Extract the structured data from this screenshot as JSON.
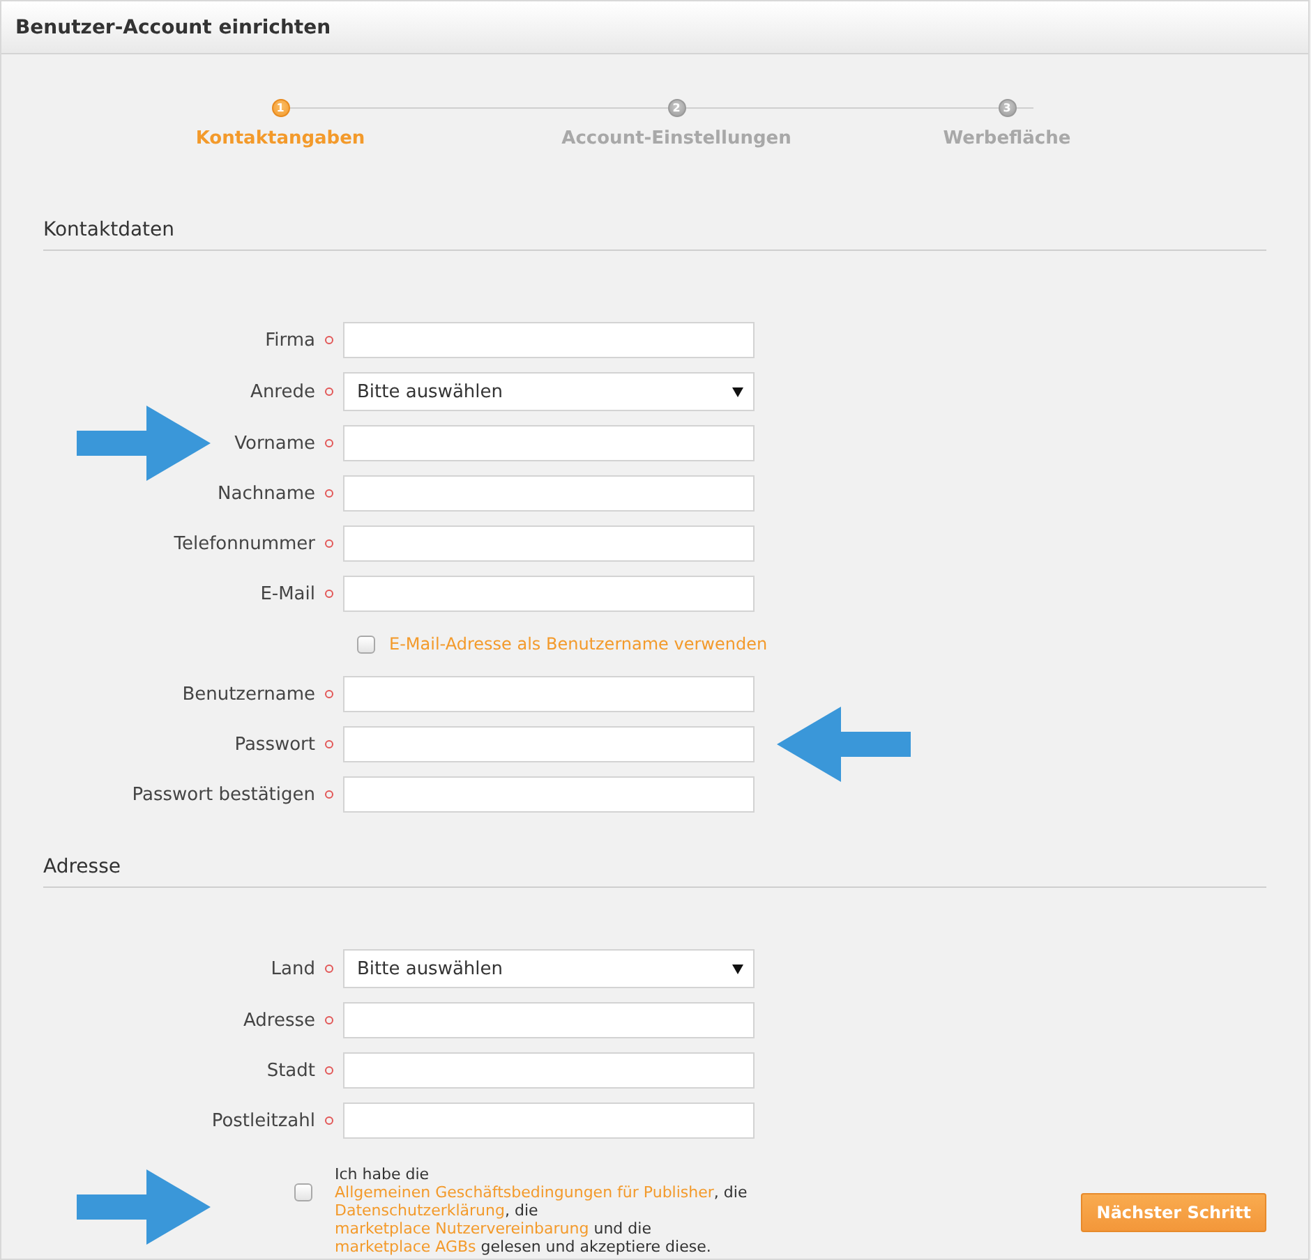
{
  "window": {
    "title": "Benutzer-Account einrichten"
  },
  "steps": [
    {
      "number": "1",
      "label": "Kontaktangaben",
      "selected": true
    },
    {
      "number": "2",
      "label": "Account-Einstellungen",
      "selected": false
    },
    {
      "number": "3",
      "label": "Werbefläche",
      "selected": false
    }
  ],
  "sections": [
    {
      "title": "Kontaktdaten",
      "fields": [
        {
          "kind": "text",
          "label": "Firma",
          "required": true
        },
        {
          "kind": "select",
          "label": "Anrede",
          "required": true,
          "value": "Bitte auswählen"
        },
        {
          "kind": "text",
          "label": "Vorname",
          "required": true,
          "arrow_before": true
        },
        {
          "kind": "text",
          "label": "Nachname",
          "required": true
        },
        {
          "kind": "text",
          "label": "Telefonnummer",
          "required": true
        },
        {
          "kind": "text",
          "label": "E-Mail",
          "required": true
        },
        {
          "kind": "checkbox",
          "label": "E-Mail-Adresse als Benutzername verwenden",
          "checked": false
        },
        {
          "kind": "text",
          "label": "Benutzername",
          "required": true
        },
        {
          "kind": "password",
          "label": "Passwort",
          "required": true,
          "arrow_after": true
        },
        {
          "kind": "password",
          "label": "Passwort bestätigen",
          "required": true
        }
      ]
    },
    {
      "title": "Adresse",
      "fields": [
        {
          "kind": "select",
          "label": "Land",
          "required": true,
          "value": "Bitte auswählen"
        },
        {
          "kind": "text",
          "label": "Adresse",
          "required": true
        },
        {
          "kind": "text",
          "label": "Stadt",
          "required": true
        },
        {
          "kind": "text",
          "label": "Postleitzahl",
          "required": true
        }
      ]
    }
  ],
  "agreement": {
    "checked": false,
    "arrow_before": true,
    "parts": [
      {
        "kind": "text",
        "text": "Ich habe die "
      },
      {
        "kind": "link",
        "text": "Allgemeinen Geschäftsbedingungen für Publisher"
      },
      {
        "kind": "text",
        "text": ", die "
      },
      {
        "kind": "link",
        "text": "Datenschutzerklärung"
      },
      {
        "kind": "text",
        "text": ", die "
      },
      {
        "kind": "link",
        "text": "marketplace Nutzervereinbarung"
      },
      {
        "kind": "text",
        "text": " und die "
      },
      {
        "kind": "link",
        "text": "marketplace AGBs"
      },
      {
        "kind": "text",
        "text": " gelesen und akzeptiere diese."
      }
    ]
  },
  "next_button": "Nächster Schritt"
}
